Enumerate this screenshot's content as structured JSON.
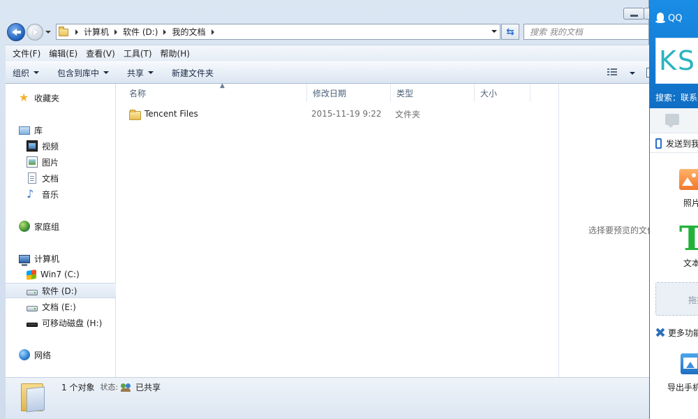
{
  "address": {
    "crumbs": [
      "计算机",
      "软件 (D:)",
      "我的文档"
    ]
  },
  "search": {
    "placeholder": "搜索 我的文档"
  },
  "menubar": {
    "items": [
      "文件(F)",
      "编辑(E)",
      "查看(V)",
      "工具(T)",
      "帮助(H)"
    ]
  },
  "toolbar": {
    "organize": "组织",
    "include_library": "包含到库中",
    "share": "共享",
    "new_folder": "新建文件夹"
  },
  "navpane": {
    "favorites": "收藏夹",
    "libraries": "库",
    "lib_items": [
      "视频",
      "图片",
      "文档",
      "音乐"
    ],
    "homegroup": "家庭组",
    "computer": "计算机",
    "drives": [
      "Win7 (C:)",
      "软件 (D:)",
      "文档 (E:)",
      "可移动磁盘 (H:)"
    ],
    "network": "网络"
  },
  "list": {
    "columns": [
      "名称",
      "修改日期",
      "类型",
      "大小"
    ],
    "rows": [
      {
        "name": "Tencent Files",
        "modified": "2015-11-19 9:22",
        "type": "文件夹",
        "size": ""
      }
    ]
  },
  "preview": {
    "empty_text": "选择要预览的文件。"
  },
  "status": {
    "count": "1 个对象",
    "state_label": "状态:",
    "state_value": "已共享"
  },
  "qq": {
    "title": "QQ",
    "avatar_text": "KS",
    "search_label": "搜索：联系人",
    "send_to": "发送到我的手机",
    "photo": "照片",
    "text": "文本",
    "text_glyph": "T",
    "drop": "拖拽文件到此",
    "more": "更多功能",
    "export": "导出手机相册"
  },
  "colors": {
    "qq_blue": "#1a8de6",
    "explorer_frame": "#dbe6f3"
  }
}
